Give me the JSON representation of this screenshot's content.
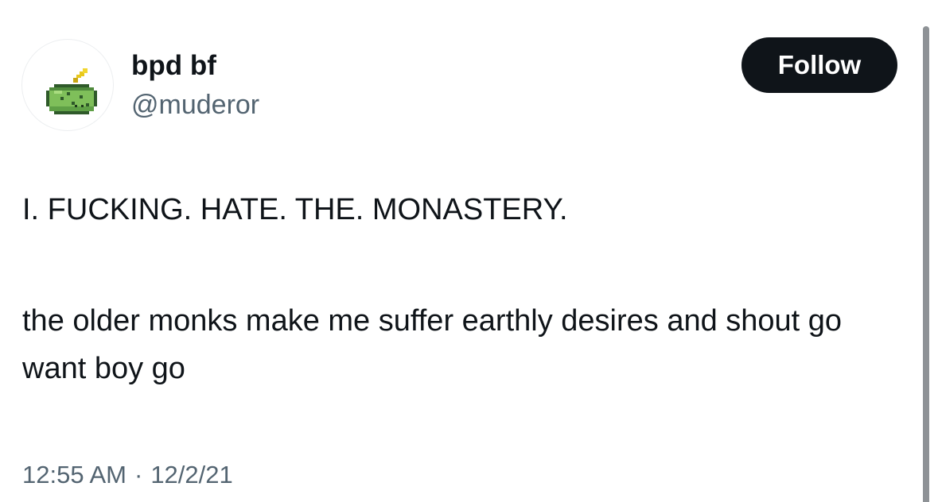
{
  "author": {
    "display_name": "bpd bf",
    "handle": "@muderor",
    "avatar_icon": "pixel-melon-sprite-icon"
  },
  "follow_button": {
    "label": "Follow"
  },
  "tweet": {
    "paragraphs": [
      "I. FUCKING. HATE. THE. MONASTERY.",
      "the older monks make me suffer earthly desires and shout go want boy go"
    ]
  },
  "meta": {
    "time": "12:55 AM",
    "separator": "·",
    "date": "12/2/21"
  },
  "colors": {
    "text_primary": "#0f1419",
    "text_secondary": "#536471",
    "button_bg": "#0f1419",
    "button_text": "#ffffff",
    "scrollbar": "#8e9296"
  }
}
